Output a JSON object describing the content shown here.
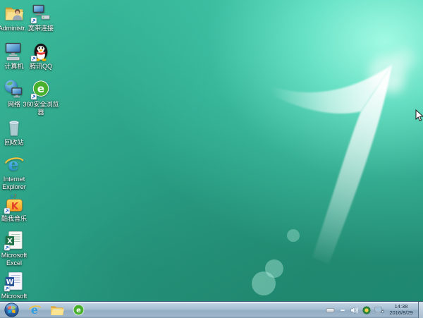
{
  "desktop": {
    "wallpaper_figure": "7",
    "colors": {
      "background_teal": "#2fae92",
      "background_highlight": "#8df5dc",
      "background_shadow": "#1f8a72",
      "taskbar": "#a7bed2"
    },
    "icons": [
      {
        "name": "administrator-folder",
        "label": "Administr..."
      },
      {
        "name": "broadband-connection",
        "label": "宽带连接"
      },
      {
        "name": "computer",
        "label": "计算机"
      },
      {
        "name": "tencent-qq",
        "label": "腾讯QQ"
      },
      {
        "name": "network",
        "label": "网络"
      },
      {
        "name": "360-safe-browser",
        "label": "360安全浏览器"
      },
      {
        "name": "recycle-bin",
        "label": "回收站"
      },
      {
        "name": "internet-explorer",
        "label": "Internet Explorer"
      },
      {
        "name": "kuwo-music",
        "label": "酷我音乐"
      },
      {
        "name": "microsoft-excel",
        "label": "Microsoft Excel"
      },
      {
        "name": "microsoft-word",
        "label": "Microsoft Word"
      }
    ]
  },
  "taskbar": {
    "pinned": [
      "start",
      "internet-explorer",
      "windows-explorer",
      "360-safe-browser"
    ],
    "tray_icons": [
      "hidden-icons",
      "language-bar",
      "volume",
      "360-safety",
      "network"
    ],
    "clock": {
      "time": "14:38",
      "date": "2016/8/29"
    }
  }
}
